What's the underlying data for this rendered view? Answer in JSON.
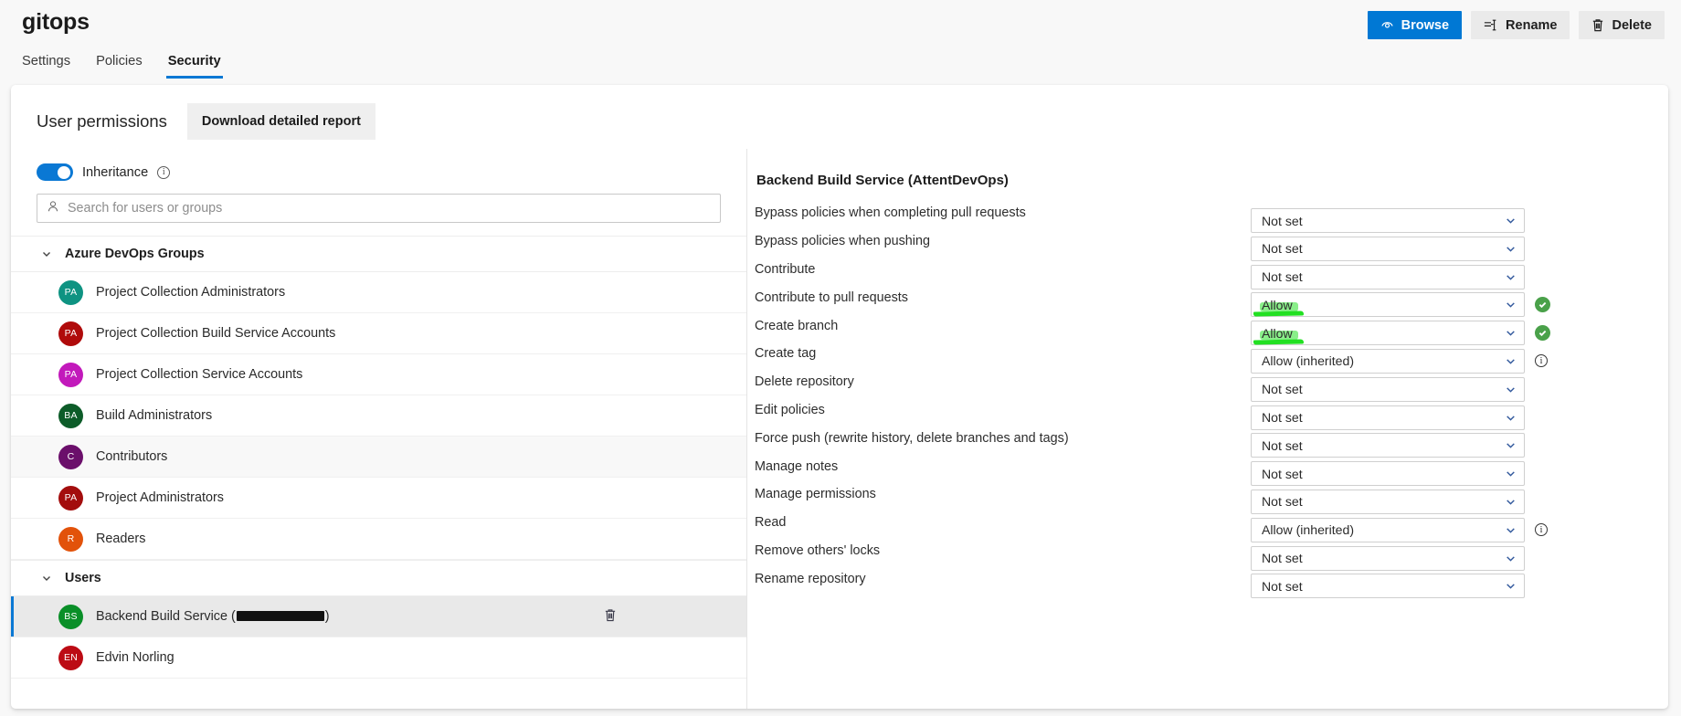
{
  "header": {
    "title": "gitops",
    "actions": [
      {
        "label": "Browse",
        "icon": "browse-icon",
        "primary": true
      },
      {
        "label": "Rename",
        "icon": "rename-icon",
        "primary": false
      },
      {
        "label": "Delete",
        "icon": "trash-icon",
        "primary": false
      }
    ],
    "tabs": [
      {
        "label": "Settings",
        "active": false
      },
      {
        "label": "Policies",
        "active": false
      },
      {
        "label": "Security",
        "active": true
      }
    ]
  },
  "card": {
    "heading": "User permissions",
    "download_report_label": "Download detailed report",
    "inheritance": {
      "label": "Inheritance",
      "enabled": true,
      "info_glyph": "ⓘ"
    },
    "search": {
      "placeholder": "Search for users or groups",
      "value": ""
    }
  },
  "identity_list": {
    "groups_section": {
      "label": "Azure DevOps Groups",
      "expanded": true,
      "items": [
        {
          "initials": "PA",
          "label": "Project Collection Administrators",
          "color": "#0e9382"
        },
        {
          "initials": "PA",
          "label": "Project Collection Build Service Accounts",
          "color": "#b00b0b"
        },
        {
          "initials": "PA",
          "label": "Project Collection Service Accounts",
          "color": "#c219bb"
        },
        {
          "initials": "BA",
          "label": "Build Administrators",
          "color": "#0d5c29"
        },
        {
          "initials": "C",
          "label": "Contributors",
          "color": "#6b0f6b"
        },
        {
          "initials": "PA",
          "label": "Project Administrators",
          "color": "#a30d0d"
        },
        {
          "initials": "R",
          "label": "Readers",
          "color": "#e2520a"
        }
      ]
    },
    "users_section": {
      "label": "Users",
      "expanded": true,
      "items": [
        {
          "initials": "BS",
          "label_prefix": "Backend Build Service (",
          "label_suffix": ")",
          "redacted": true,
          "color": "#0a8f28",
          "selected": true
        },
        {
          "initials": "EN",
          "label": "Edvin Norling",
          "color": "#bc0b14",
          "selected": false
        }
      ]
    }
  },
  "permissions_panel": {
    "title": "Backend Build Service (AttentDevOps)",
    "rows": [
      {
        "name": "Bypass policies when completing pull requests",
        "value": "Not set",
        "highlighted": false,
        "badge": "none"
      },
      {
        "name": "Bypass policies when pushing",
        "value": "Not set",
        "highlighted": false,
        "badge": "none"
      },
      {
        "name": "Contribute",
        "value": "Not set",
        "highlighted": false,
        "badge": "none"
      },
      {
        "name": "Contribute to pull requests",
        "value": "Allow",
        "highlighted": true,
        "badge": "check"
      },
      {
        "name": "Create branch",
        "value": "Allow",
        "highlighted": true,
        "badge": "check"
      },
      {
        "name": "Create tag",
        "value": "Allow (inherited)",
        "highlighted": false,
        "badge": "info"
      },
      {
        "name": "Delete repository",
        "value": "Not set",
        "highlighted": false,
        "badge": "none"
      },
      {
        "name": "Edit policies",
        "value": "Not set",
        "highlighted": false,
        "badge": "none"
      },
      {
        "name": "Force push (rewrite history, delete branches and tags)",
        "value": "Not set",
        "highlighted": false,
        "badge": "none"
      },
      {
        "name": "Manage notes",
        "value": "Not set",
        "highlighted": false,
        "badge": "none"
      },
      {
        "name": "Manage permissions",
        "value": "Not set",
        "highlighted": false,
        "badge": "none"
      },
      {
        "name": "Read",
        "value": "Allow (inherited)",
        "highlighted": false,
        "badge": "info"
      },
      {
        "name": "Remove others' locks",
        "value": "Not set",
        "highlighted": false,
        "badge": "none"
      },
      {
        "name": "Rename repository",
        "value": "Not set",
        "highlighted": false,
        "badge": "none"
      }
    ]
  },
  "colors": {
    "accent": "#0a78d4",
    "highlighter": "#22e022",
    "check_green": "#4aa14a"
  }
}
